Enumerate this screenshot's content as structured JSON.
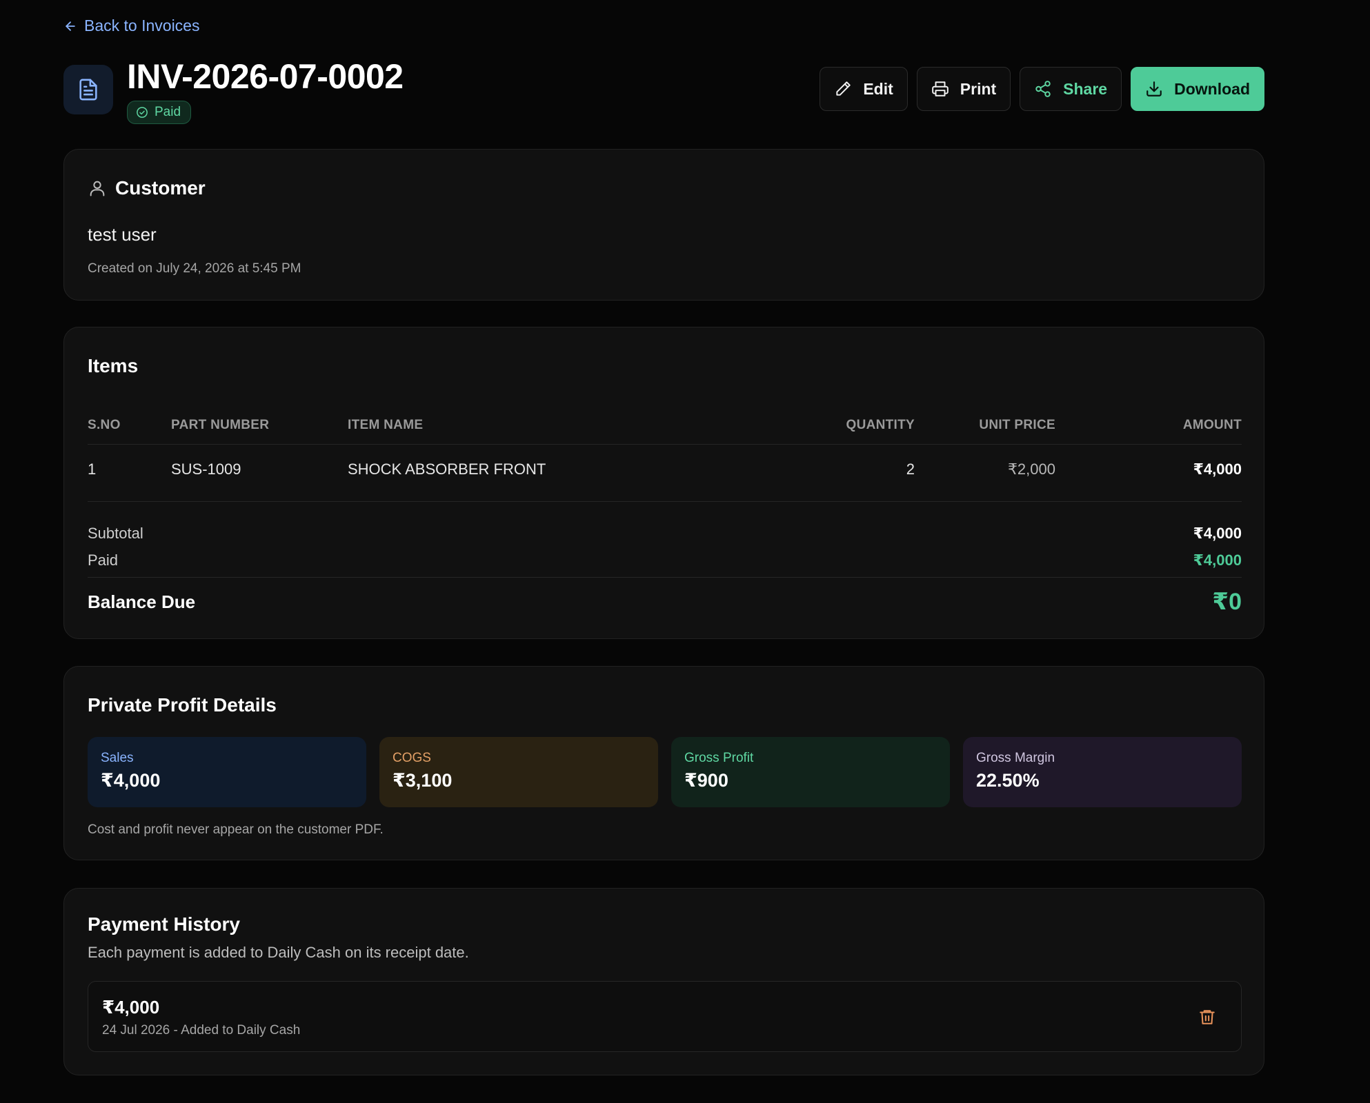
{
  "nav": {
    "back_label": "Back to Invoices"
  },
  "invoice": {
    "number": "INV-2026-07-0002",
    "status": "Paid"
  },
  "actions": {
    "edit": "Edit",
    "print": "Print",
    "share": "Share",
    "download": "Download"
  },
  "customer": {
    "title": "Customer",
    "name": "test user",
    "created": "Created on July 24, 2026 at 5:45 PM"
  },
  "items": {
    "title": "Items",
    "columns": [
      "S.NO",
      "PART NUMBER",
      "ITEM NAME",
      "QUANTITY",
      "UNIT PRICE",
      "AMOUNT"
    ],
    "rows": [
      {
        "sno": "1",
        "part_number": "SUS-1009",
        "item_name": "SHOCK ABSORBER FRONT",
        "quantity": "2",
        "unit_price": "₹2,000",
        "amount": "₹4,000"
      }
    ],
    "subtotal_label": "Subtotal",
    "subtotal": "₹4,000",
    "paid_label": "Paid",
    "paid": "₹4,000",
    "balance_label": "Balance Due",
    "balance": "₹0"
  },
  "profit": {
    "title": "Private Profit Details",
    "sales_label": "Sales",
    "sales": "₹4,000",
    "cogs_label": "COGS",
    "cogs": "₹3,100",
    "gross_profit_label": "Gross Profit",
    "gross_profit": "₹900",
    "gross_margin_label": "Gross Margin",
    "gross_margin": "22.50%",
    "note": "Cost and profit never appear on the customer PDF."
  },
  "payments": {
    "title": "Payment History",
    "subtitle": "Each payment is added to Daily Cash on its receipt date.",
    "entries": [
      {
        "amount": "₹4,000",
        "meta": "24 Jul 2026 - Added to Daily Cash"
      }
    ]
  },
  "colors": {
    "background": "#060606",
    "card": "#111111",
    "accent_green": "#4ecb98",
    "link_blue": "#8ab4ff",
    "delete_orange": "#e8925a"
  }
}
